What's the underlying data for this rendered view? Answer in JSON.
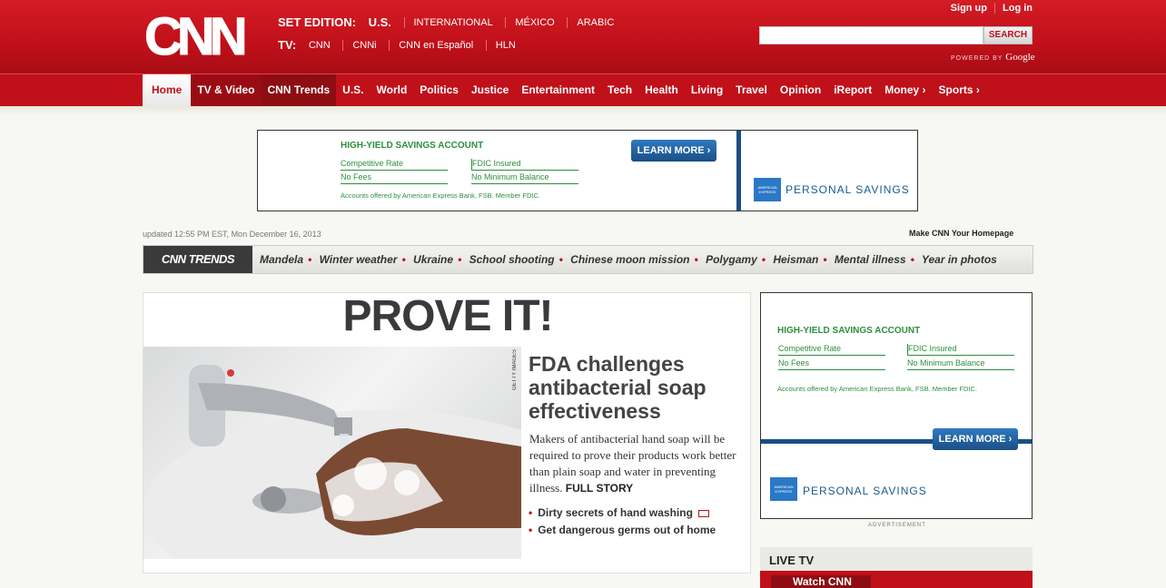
{
  "header": {
    "logo_text": "CNN",
    "edition_label": "SET EDITION:",
    "edition_current": "U.S.",
    "editions": [
      "INTERNATIONAL",
      "MÉXICO",
      "ARABIC"
    ],
    "tv_label": "TV:",
    "tv_links": [
      "CNN",
      "CNNi",
      "CNN en Español",
      "HLN"
    ],
    "signup": "Sign up",
    "login": "Log in",
    "search_button": "SEARCH",
    "powered_by": "POWERED BY",
    "google": "Google"
  },
  "nav": {
    "items": [
      {
        "label": "Home"
      },
      {
        "label": "TV & Video"
      },
      {
        "label": "CNN Trends"
      },
      {
        "label": "U.S."
      },
      {
        "label": "World"
      },
      {
        "label": "Politics"
      },
      {
        "label": "Justice"
      },
      {
        "label": "Entertainment"
      },
      {
        "label": "Tech"
      },
      {
        "label": "Health"
      },
      {
        "label": "Living"
      },
      {
        "label": "Travel"
      },
      {
        "label": "Opinion"
      },
      {
        "label": "iReport"
      },
      {
        "label": "Money ›"
      },
      {
        "label": "Sports ›"
      }
    ]
  },
  "ad": {
    "title": "HIGH-YIELD SAVINGS ACCOUNT",
    "field1": "Competitive Rate",
    "field2": "FDIC Insured",
    "field3": "No Fees",
    "field4": "No Minimum Balance",
    "disclaimer": "Accounts offered by American Express Bank, FSB. Member FDIC.",
    "cta": "LEARN MORE ›",
    "brand": "PERSONAL SAVINGS",
    "amex": "AMERICAN EXPRESS",
    "advertisement": "ADVERTISEMENT"
  },
  "meta": {
    "updated": "updated 12:55 PM EST, Mon December 16, 2013",
    "make_homepage": "Make CNN Your Homepage"
  },
  "trends": {
    "label": "CNN TRENDS",
    "items": [
      "Mandela",
      "Winter weather",
      "Ukraine",
      "School shooting",
      "Chinese moon mission",
      "Polygamy",
      "Heisman",
      "Mental illness",
      "Year in photos"
    ]
  },
  "story": {
    "kicker": "PROVE IT!",
    "photo_credit": "GETTY IMAGES",
    "headline": "FDA challenges antibacterial soap effectiveness",
    "body": "Makers of antibacterial hand soap will be required to prove their products work better than plain soap and water in preventing illness.",
    "full_story": "FULL STORY",
    "related": [
      "Dirty secrets of hand washing",
      "Get dangerous germs out of home"
    ]
  },
  "sidebar": {
    "live_tv": "LIVE TV",
    "watch": "Watch CNN"
  },
  "colors": {
    "brand_red": "#c0101a",
    "ad_green": "#2d8f3c",
    "ad_blue": "#1c5a8c"
  }
}
